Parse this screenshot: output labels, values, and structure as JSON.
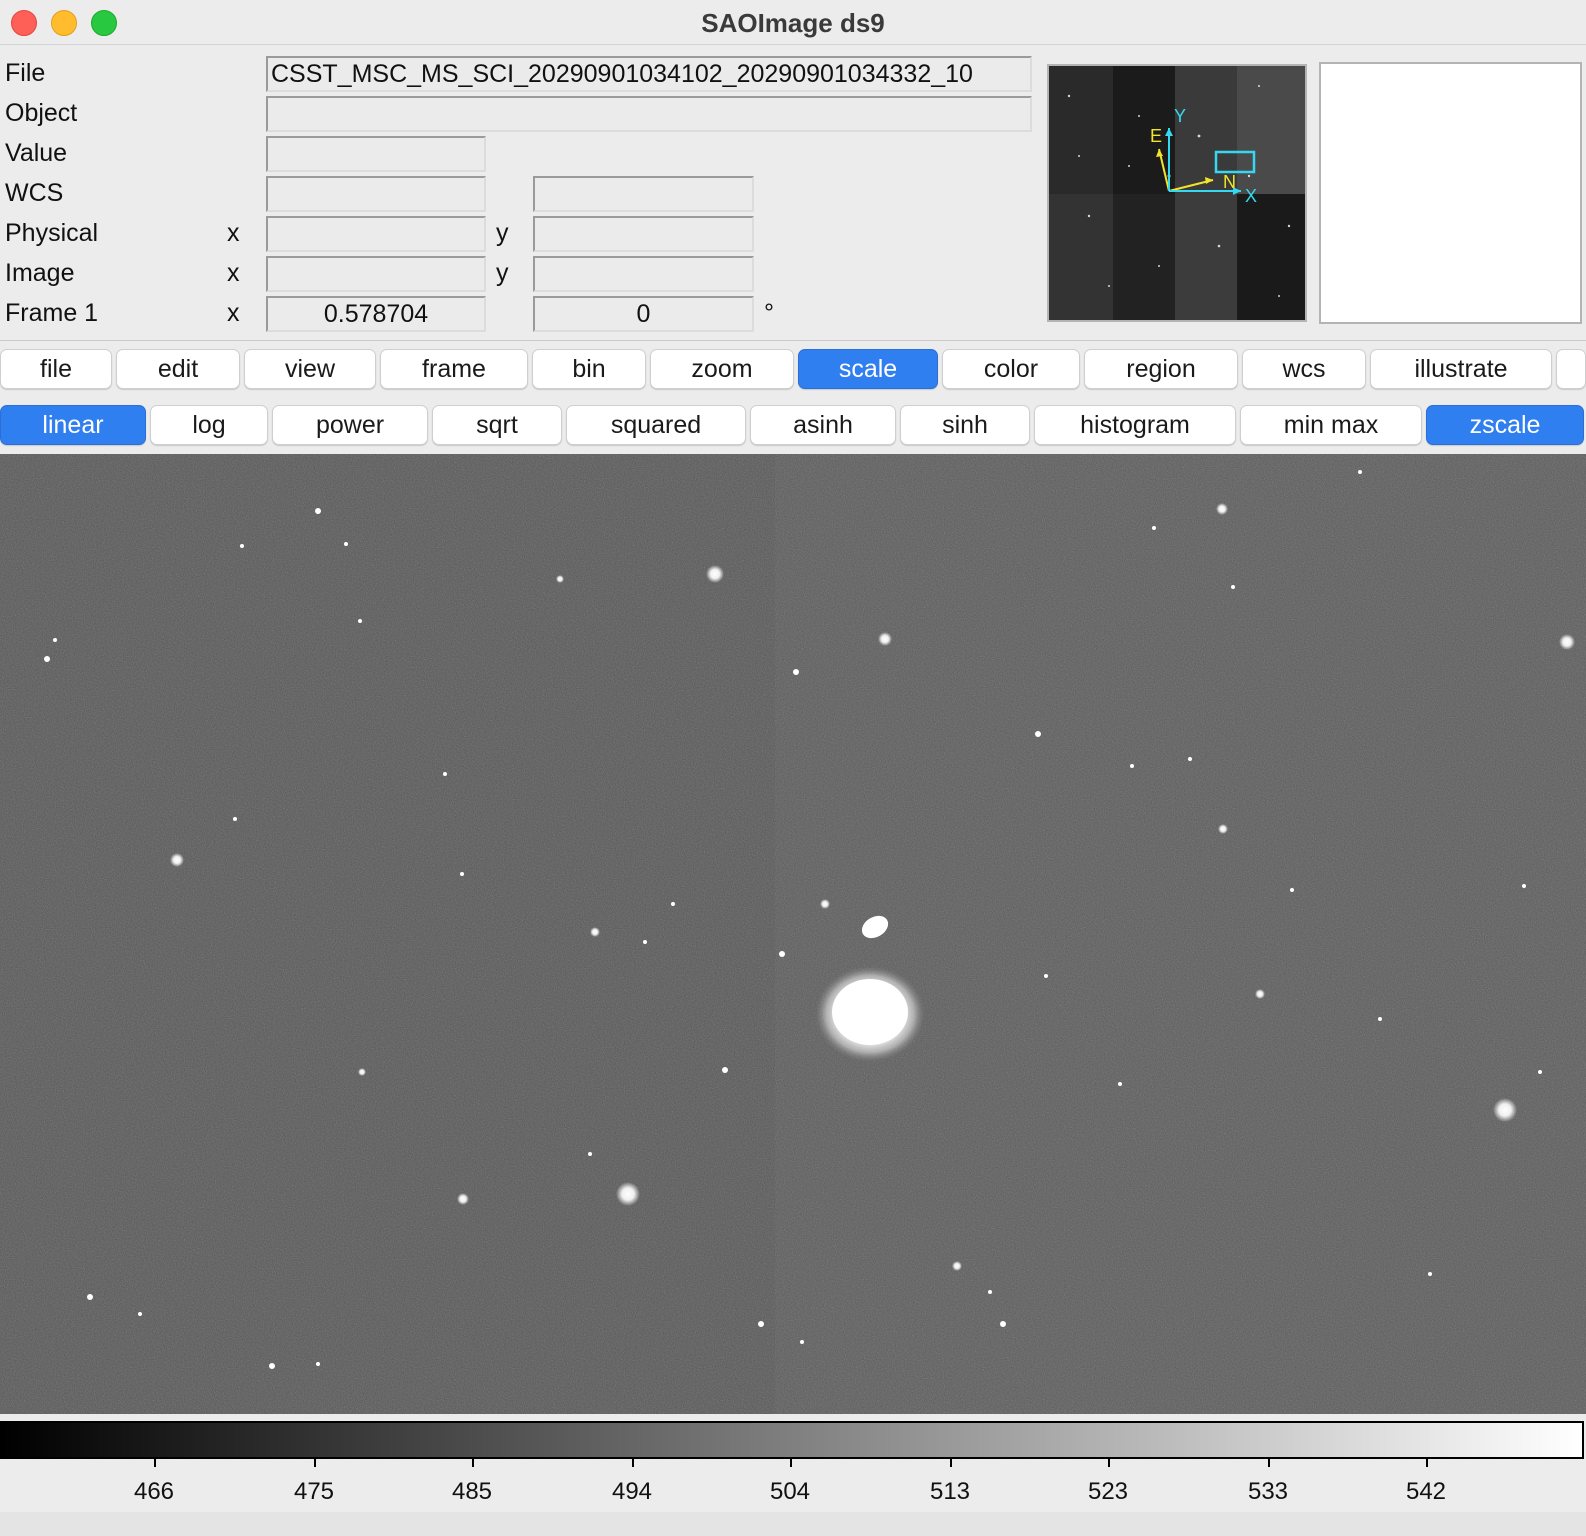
{
  "window": {
    "title": "SAOImage ds9"
  },
  "info": {
    "file_label": "File",
    "file_value": "CSST_MSC_MS_SCI_20290901034102_20290901034332_10",
    "object_label": "Object",
    "object_value": "",
    "value_label": "Value",
    "value_value": "",
    "wcs_label": "WCS",
    "wcs_x": "",
    "wcs_y": "",
    "physical_label": "Physical",
    "physical_x_label": "x",
    "physical_y_label": "y",
    "physical_x": "",
    "physical_y": "",
    "image_label": "Image",
    "image_x_label": "x",
    "image_y_label": "y",
    "image_x": "",
    "image_y": "",
    "frame_label": "Frame 1",
    "frame_x_label": "x",
    "frame_zoom": "0.578704",
    "frame_angle": "0",
    "angle_unit": "°"
  },
  "panner": {
    "labels": {
      "y": "Y",
      "e": "E",
      "n": "N",
      "x": "X"
    },
    "compass_yellow": "#f2e529",
    "compass_cyan": "#35d8f0"
  },
  "menu": {
    "items": [
      "file",
      "edit",
      "view",
      "frame",
      "bin",
      "zoom",
      "scale",
      "color",
      "region",
      "wcs",
      "illustrate"
    ],
    "active": "scale"
  },
  "scale_buttons": {
    "items": [
      "linear",
      "log",
      "power",
      "sqrt",
      "squared",
      "asinh",
      "sinh",
      "histogram",
      "min max",
      "zscale"
    ],
    "active": [
      "linear",
      "zscale"
    ]
  },
  "colorbar": {
    "ticks": [
      "466",
      "475",
      "485",
      "494",
      "504",
      "513",
      "523",
      "533",
      "542"
    ]
  },
  "colors": {
    "accent": "#2f7ff0",
    "background": "#ececec"
  }
}
